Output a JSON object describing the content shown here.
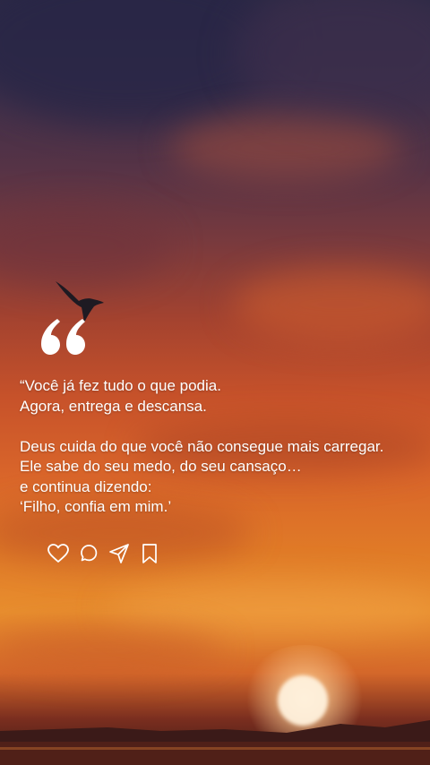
{
  "quote": {
    "lines": [
      "“Você já fez tudo o que podia.",
      "Agora, entrega e descansa.",
      "",
      "Deus cuida do que você não consegue mais carregar.",
      "Ele sabe do seu medo, do seu cansaço…",
      "e continua dizendo:",
      "‘Filho, confia em mim.’"
    ]
  },
  "actions": {
    "icons": [
      "heart-icon",
      "comment-icon",
      "share-icon",
      "bookmark-icon"
    ]
  },
  "colors": {
    "text": "#ffffff",
    "sky_top": "#2c2a45",
    "sky_mid": "#c7522a",
    "horizon": "#e88e2e"
  }
}
